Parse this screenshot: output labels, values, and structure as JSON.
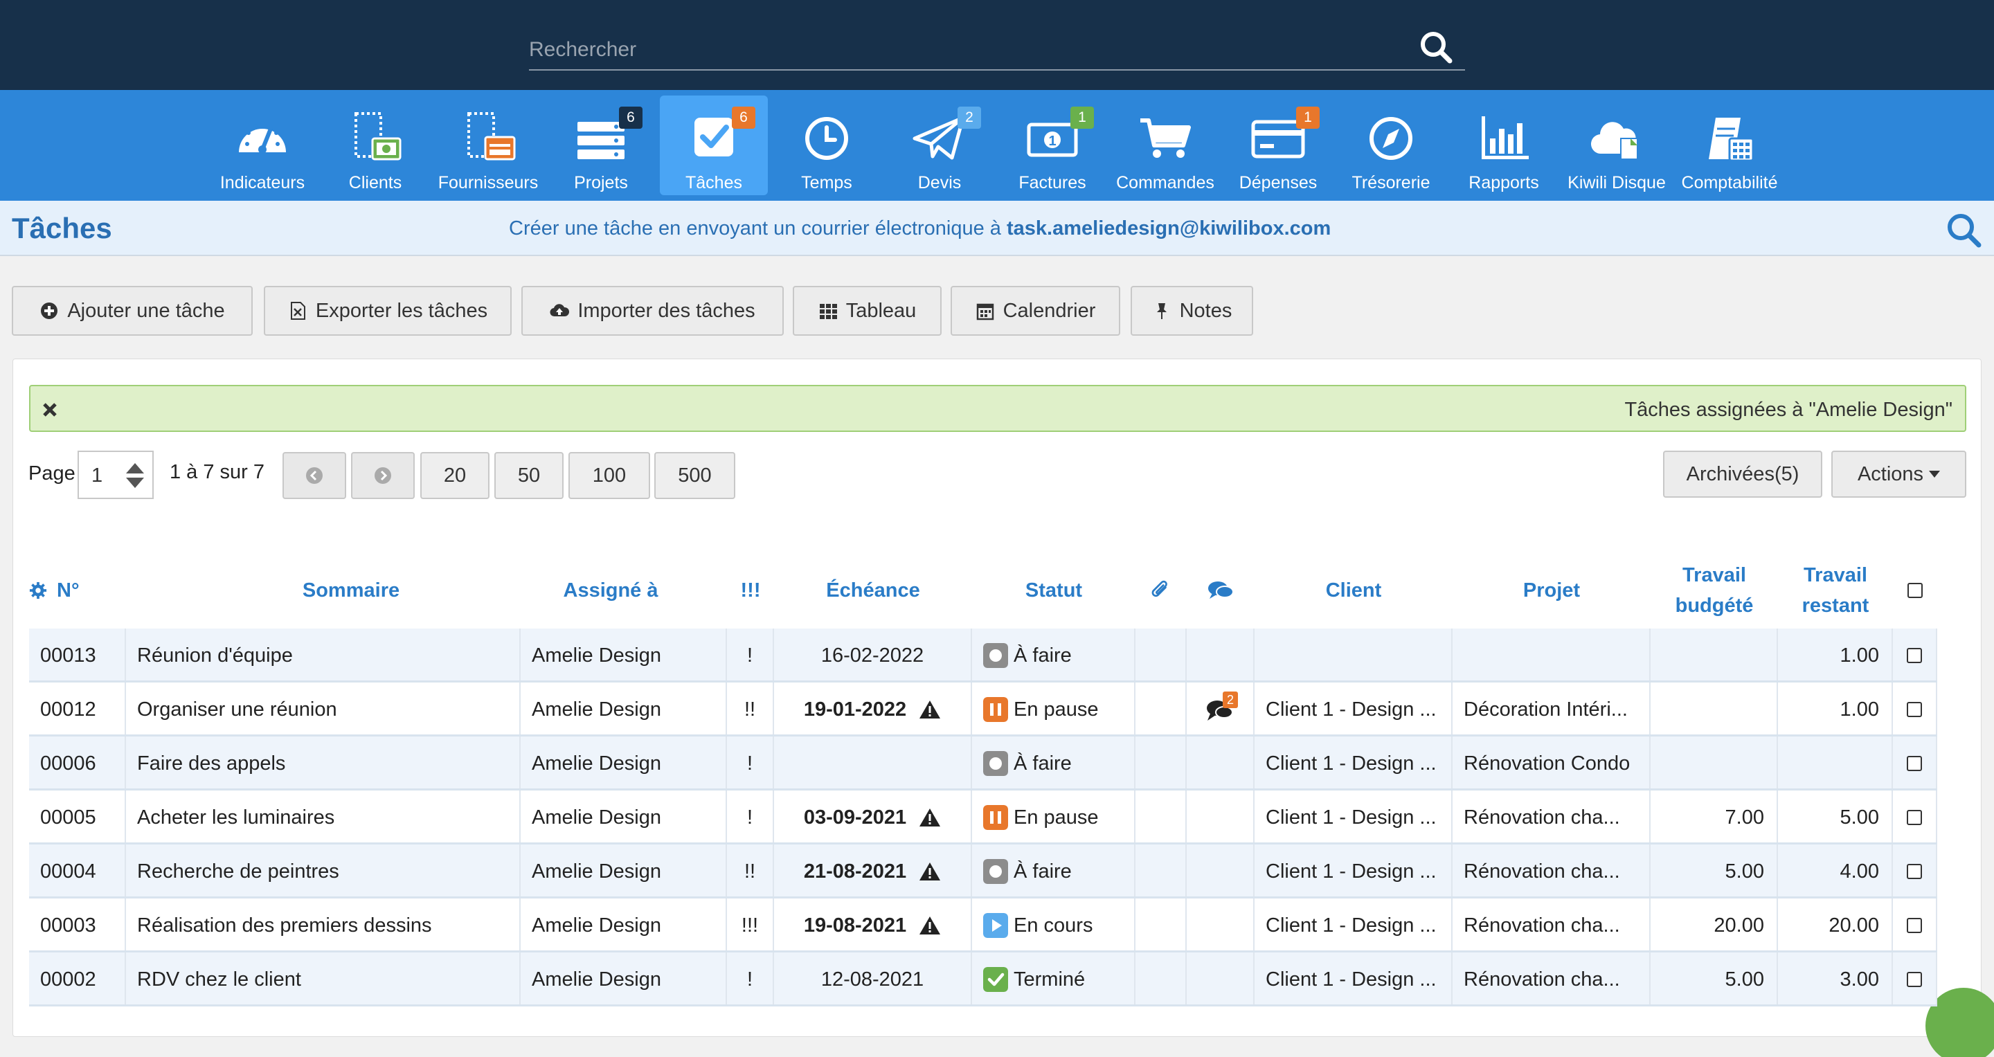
{
  "search": {
    "placeholder": "Rechercher"
  },
  "nav": [
    {
      "label": "Indicateurs",
      "icon": "gauge-icon",
      "badge": ""
    },
    {
      "label": "Clients",
      "icon": "clients-icon",
      "badge": ""
    },
    {
      "label": "Fournisseurs",
      "icon": "suppliers-icon",
      "badge": ""
    },
    {
      "label": "Projets",
      "icon": "projects-icon",
      "badge": "6"
    },
    {
      "label": "Tâches",
      "icon": "tasks-icon",
      "badge": "6",
      "active": true
    },
    {
      "label": "Temps",
      "icon": "clock-icon",
      "badge": ""
    },
    {
      "label": "Devis",
      "icon": "paper-plane-icon",
      "badge": "2"
    },
    {
      "label": "Factures",
      "icon": "invoice-icon",
      "badge": "1"
    },
    {
      "label": "Commandes",
      "icon": "cart-icon",
      "badge": ""
    },
    {
      "label": "Dépenses",
      "icon": "credit-card-icon",
      "badge": "1"
    },
    {
      "label": "Trésorerie",
      "icon": "compass-icon",
      "badge": ""
    },
    {
      "label": "Rapports",
      "icon": "bar-chart-icon",
      "badge": ""
    },
    {
      "label": "Kiwili Disque",
      "icon": "cloud-icon",
      "badge": ""
    },
    {
      "label": "Comptabilité",
      "icon": "accounting-icon",
      "badge": ""
    }
  ],
  "colors": {
    "topbar": "#17304a",
    "nav": "#2d86d9",
    "accent": "#2a7cc7",
    "badge_orange": "#e8772b",
    "badge_dark": "#17304a",
    "badge_blue": "#5aabec",
    "badge_green": "#6ab04c"
  },
  "header": {
    "title": "Tâches",
    "email_hint_prefix": "Créer une tâche en envoyant un courrier électronique à ",
    "email": "task.ameliedesign@kiwilibox.com"
  },
  "toolbar": {
    "add": "Ajouter une tâche",
    "export": "Exporter les tâches",
    "import": "Importer des tâches",
    "board": "Tableau",
    "calendar": "Calendrier",
    "notes": "Notes"
  },
  "filter": {
    "text": "Tâches assignées à \"Amelie Design\""
  },
  "pagination": {
    "page_label": "Page",
    "page_value": "1",
    "range": "1 à 7 sur 7",
    "sizes": [
      "20",
      "50",
      "100",
      "500"
    ],
    "archived": "Archivées(5)",
    "actions": "Actions"
  },
  "table": {
    "headers": {
      "num": "N°",
      "summary": "Sommaire",
      "assigned": "Assigné à",
      "priority": "!!!",
      "due": "Échéance",
      "status": "Statut",
      "client": "Client",
      "project": "Projet",
      "budget": [
        "Travail",
        "budgété"
      ],
      "remaining": [
        "Travail",
        "restant"
      ]
    },
    "rows": [
      {
        "num": "00013",
        "summary": "Réunion d'équipe",
        "assigned": "Amelie Design",
        "priority": "!",
        "due": "16-02-2022",
        "overdue": false,
        "status": "À faire",
        "status_type": "todo",
        "comments": "",
        "client": "",
        "project": "",
        "budget": "",
        "remaining": "1.00"
      },
      {
        "num": "00012",
        "summary": "Organiser une réunion",
        "assigned": "Amelie Design",
        "priority": "!!",
        "due": "19-01-2022",
        "overdue": true,
        "status": "En pause",
        "status_type": "paused",
        "comments": "2",
        "client": "Client 1 - Design ...",
        "project": "Décoration Intéri...",
        "budget": "",
        "remaining": "1.00"
      },
      {
        "num": "00006",
        "summary": "Faire des appels",
        "assigned": "Amelie Design",
        "priority": "!",
        "due": "",
        "overdue": false,
        "status": "À faire",
        "status_type": "todo",
        "comments": "",
        "client": "Client 1 - Design ...",
        "project": "Rénovation Condo",
        "budget": "",
        "remaining": ""
      },
      {
        "num": "00005",
        "summary": "Acheter les luminaires",
        "assigned": "Amelie Design",
        "priority": "!",
        "due": "03-09-2021",
        "overdue": true,
        "status": "En pause",
        "status_type": "paused",
        "comments": "",
        "client": "Client 1 - Design ...",
        "project": "Rénovation cha...",
        "budget": "7.00",
        "remaining": "5.00"
      },
      {
        "num": "00004",
        "summary": "Recherche de peintres",
        "assigned": "Amelie Design",
        "priority": "!!",
        "due": "21-08-2021",
        "overdue": true,
        "status": "À faire",
        "status_type": "todo",
        "comments": "",
        "client": "Client 1 - Design ...",
        "project": "Rénovation cha...",
        "budget": "5.00",
        "remaining": "4.00"
      },
      {
        "num": "00003",
        "summary": "Réalisation des premiers dessins",
        "assigned": "Amelie Design",
        "priority": "!!!",
        "due": "19-08-2021",
        "overdue": true,
        "status": "En cours",
        "status_type": "progress",
        "comments": "",
        "client": "Client 1 - Design ...",
        "project": "Rénovation cha...",
        "budget": "20.00",
        "remaining": "20.00"
      },
      {
        "num": "00002",
        "summary": "RDV chez le client",
        "assigned": "Amelie Design",
        "priority": "!",
        "due": "12-08-2021",
        "overdue": false,
        "status": "Terminé",
        "status_type": "done",
        "comments": "",
        "client": "Client 1 - Design ...",
        "project": "Rénovation cha...",
        "budget": "5.00",
        "remaining": "3.00"
      }
    ]
  }
}
